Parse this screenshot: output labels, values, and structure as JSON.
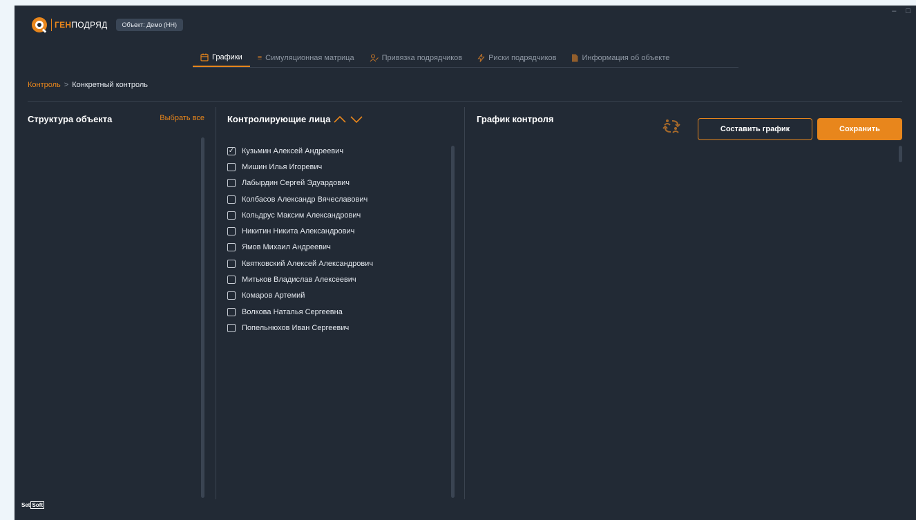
{
  "app": {
    "brand_prefix": "ГЕН",
    "brand_suffix": "ПОДРЯД",
    "object_badge": "Объект: Демо (НН)",
    "footer_brand_left": "Set",
    "footer_brand_right": "Soft",
    "window_controls": [
      "–",
      "□"
    ]
  },
  "tabs": [
    {
      "label": "Графики",
      "icon": "calendar-icon",
      "active": true
    },
    {
      "label": "Симуляционная матрица",
      "icon": "list-icon",
      "active": false
    },
    {
      "label": "Привязка подрядчиков",
      "icon": "user-link-icon",
      "active": false
    },
    {
      "label": "Риски подрядчиков",
      "icon": "lightning-icon",
      "active": false
    },
    {
      "label": "Информация об объекте",
      "icon": "document-icon",
      "active": false
    }
  ],
  "breadcrumb": {
    "parent": "Контроль",
    "separator": ">",
    "current": "Конкретный контроль"
  },
  "structure_panel": {
    "title": "Структура объекта",
    "select_all": "Выбрать все"
  },
  "persons_panel": {
    "title": "Контролирующие лица",
    "persons": [
      {
        "name": "Кузьмин Алексей Андреевич",
        "checked": true
      },
      {
        "name": "Мишин Илья Игоревич",
        "checked": false
      },
      {
        "name": "Лабырдин Сергей Эдуардович",
        "checked": false
      },
      {
        "name": "Колбасов Александр Вячеславович",
        "checked": false
      },
      {
        "name": "Кольдрус Максим Александрович",
        "checked": false
      },
      {
        "name": "Никитин Никита Александрович",
        "checked": false
      },
      {
        "name": "Ямов Михаил Андреевич",
        "checked": false
      },
      {
        "name": "Квятковский Алексей Александрович",
        "checked": false
      },
      {
        "name": "Митьков Владислав Алексеевич",
        "checked": false
      },
      {
        "name": "Комаров Артемий",
        "checked": false
      },
      {
        "name": "Волкова Наталья Сергеевна",
        "checked": false
      },
      {
        "name": "Попельнюхов Иван Сергеевич",
        "checked": false
      }
    ]
  },
  "schedule_panel": {
    "title": "График контроля",
    "make_schedule_button": "Составить график",
    "save_button": "Сохранить"
  },
  "colors": {
    "accent": "#e8861c",
    "background": "#222a35",
    "badge": "#3a4656"
  }
}
